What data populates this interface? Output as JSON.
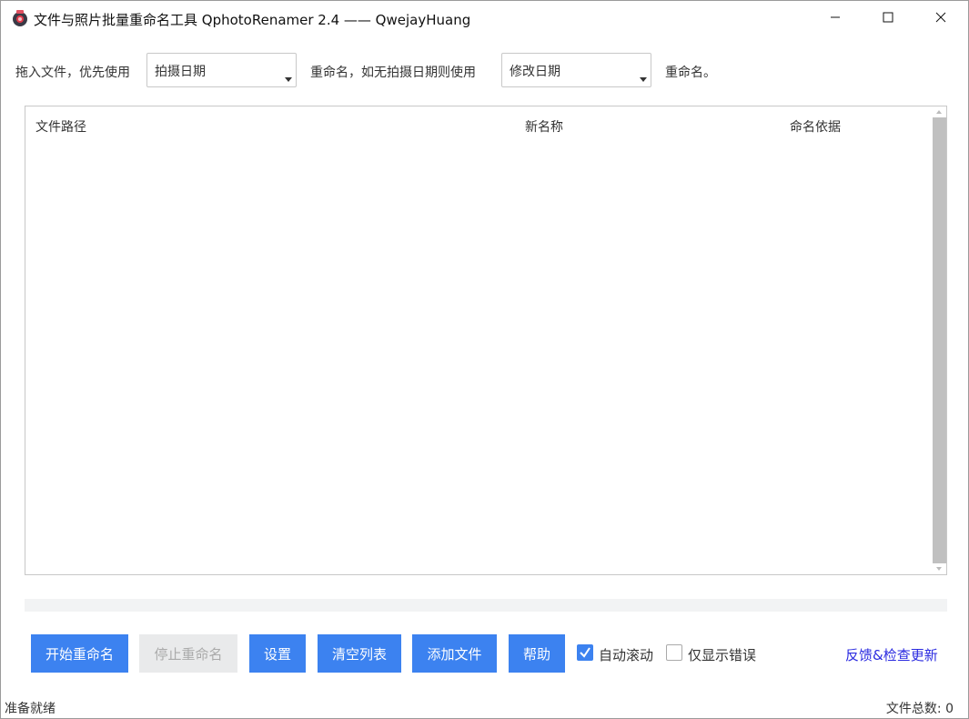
{
  "window": {
    "title": "文件与照片批量重命名工具 QphotoRenamer 2.4 —— QwejayHuang"
  },
  "controls": {
    "label_drag": "拖入文件，优先使用",
    "primary_select_value": "拍摄日期",
    "label_fallback": "重命名，如无拍摄日期则使用",
    "fallback_select_value": "修改日期",
    "label_end": "重命名。"
  },
  "list": {
    "columns": [
      "文件路径",
      "新名称",
      "命名依据"
    ]
  },
  "buttons": {
    "start": "开始重命名",
    "stop": "停止重命名",
    "settings": "设置",
    "clear": "清空列表",
    "add": "添加文件",
    "help": "帮助"
  },
  "options": {
    "auto_scroll_label": "自动滚动",
    "auto_scroll_checked": true,
    "errors_only_label": "仅显示错误",
    "errors_only_checked": false
  },
  "feedback_link": "反馈&检查更新",
  "status": {
    "text": "准备就绪",
    "file_count": "文件总数: 0"
  },
  "colors": {
    "accent": "#3c82f0",
    "link": "#2a2ae0"
  },
  "icons": {
    "app": "camera-app-icon",
    "minimize": "minimize-icon",
    "maximize": "maximize-icon",
    "close": "close-icon"
  }
}
